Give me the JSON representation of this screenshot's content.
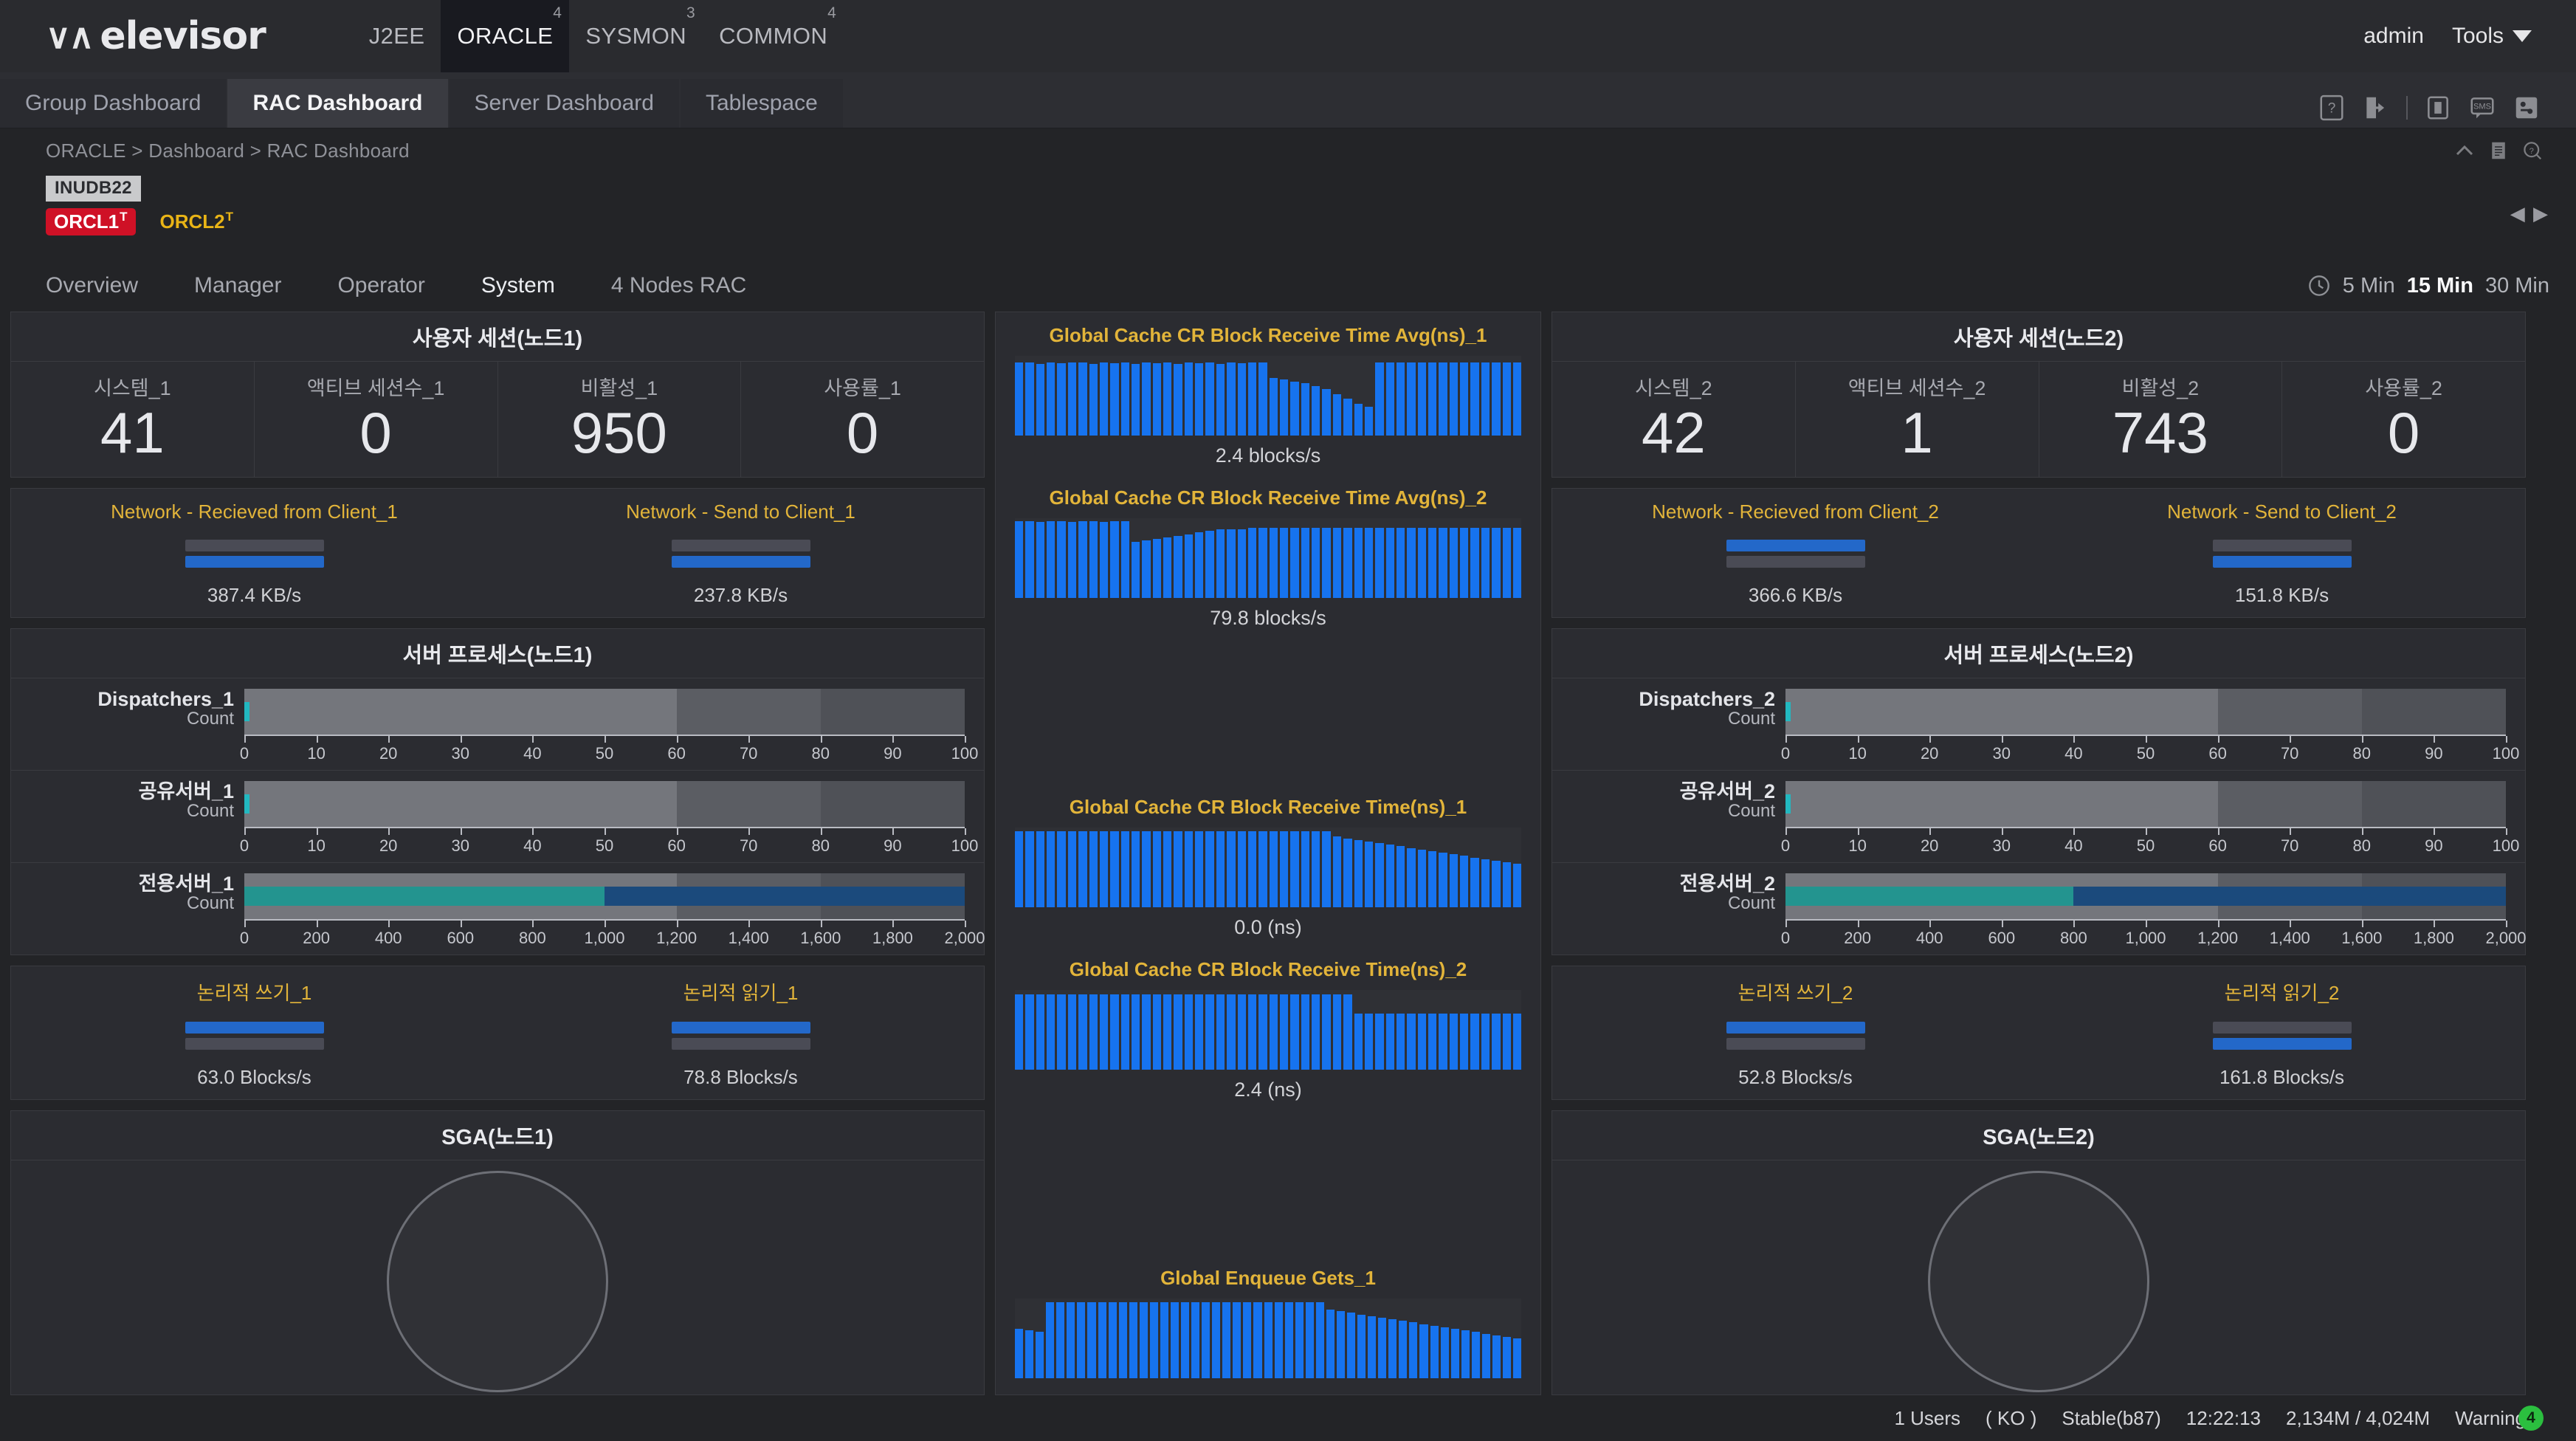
{
  "app": {
    "logo_text": "elevisor",
    "admin_label": "admin",
    "tools_label": "Tools"
  },
  "module_tabs": [
    {
      "label": "J2EE",
      "badge": "",
      "active": false
    },
    {
      "label": "ORACLE",
      "badge": "4",
      "active": true
    },
    {
      "label": "SYSMON",
      "badge": "3",
      "active": false
    },
    {
      "label": "COMMON",
      "badge": "4",
      "active": false
    }
  ],
  "tabs": [
    {
      "label": "Group Dashboard",
      "active": false
    },
    {
      "label": "RAC Dashboard",
      "active": true
    },
    {
      "label": "Server Dashboard",
      "active": false
    },
    {
      "label": "Tablespace",
      "active": false
    }
  ],
  "breadcrumb": "ORACLE > Dashboard > RAC Dashboard",
  "instances": {
    "db_tag": "INUDB22",
    "nodes": [
      {
        "label": "ORCL1",
        "sup": "T",
        "state": "red"
      },
      {
        "label": "ORCL2",
        "sup": "T",
        "state": "amber"
      }
    ],
    "arrows": "◀ ▶"
  },
  "subnav": [
    {
      "label": "Overview",
      "active": false
    },
    {
      "label": "Manager",
      "active": false
    },
    {
      "label": "Operator",
      "active": false
    },
    {
      "label": "System",
      "active": true
    },
    {
      "label": "4 Nodes RAC",
      "active": false
    }
  ],
  "time_range": {
    "options": [
      "5 Min",
      "15 Min",
      "30 Min"
    ],
    "selected": "15 Min"
  },
  "node1": {
    "session_panel_title": "사용자 세션(노드1)",
    "session_cells": [
      {
        "label": "시스템_1",
        "value": "41"
      },
      {
        "label": "액티브 세션수_1",
        "value": "0"
      },
      {
        "label": "비활성_1",
        "value": "950"
      },
      {
        "label": "사용률_1",
        "value": "0"
      }
    ],
    "network": [
      {
        "title": "Network - Recieved from Client_1",
        "value": "387.4 KB/s",
        "order": "grey-top"
      },
      {
        "title": "Network - Send to Client_1",
        "value": "237.8 KB/s",
        "order": "grey-top"
      }
    ],
    "process_panel_title": "서버 프로세스(노드1)",
    "processes": [
      {
        "name": "Dispatchers_1",
        "sub": "Count",
        "max": 100,
        "teal": 0,
        "navy": 0,
        "cyan": 1,
        "ticks": [
          "0",
          "10",
          "20",
          "30",
          "40",
          "50",
          "60",
          "70",
          "80",
          "90",
          "100"
        ]
      },
      {
        "name": "공유서버_1",
        "sub": "Count",
        "max": 100,
        "teal": 0,
        "navy": 0,
        "cyan": 1,
        "ticks": [
          "0",
          "10",
          "20",
          "30",
          "40",
          "50",
          "60",
          "70",
          "80",
          "90",
          "100"
        ]
      },
      {
        "name": "전용서버_1",
        "sub": "Count",
        "max": 2000,
        "teal": 1000,
        "navy": 2000,
        "cyan": 0,
        "ticks": [
          "0",
          "200",
          "400",
          "600",
          "800",
          "1,000",
          "1,200",
          "1,400",
          "1,600",
          "1,800",
          "2,000"
        ]
      }
    ],
    "logical": [
      {
        "title": "논리적 쓰기_1",
        "value": "63.0 Blocks/s",
        "order": "blue-top"
      },
      {
        "title": "논리적 읽기_1",
        "value": "78.8 Blocks/s",
        "order": "blue-top"
      }
    ],
    "sga_title": "SGA(노드1)"
  },
  "node2": {
    "session_panel_title": "사용자 세션(노드2)",
    "session_cells": [
      {
        "label": "시스템_2",
        "value": "42"
      },
      {
        "label": "액티브 세션수_2",
        "value": "1"
      },
      {
        "label": "비활성_2",
        "value": "743"
      },
      {
        "label": "사용률_2",
        "value": "0"
      }
    ],
    "network": [
      {
        "title": "Network - Recieved from Client_2",
        "value": "366.6 KB/s",
        "order": "blue-top"
      },
      {
        "title": "Network - Send to Client_2",
        "value": "151.8 KB/s",
        "order": "grey-top"
      }
    ],
    "process_panel_title": "서버 프로세스(노드2)",
    "processes": [
      {
        "name": "Dispatchers_2",
        "sub": "Count",
        "max": 100,
        "teal": 0,
        "navy": 0,
        "cyan": 1,
        "ticks": [
          "0",
          "10",
          "20",
          "30",
          "40",
          "50",
          "60",
          "70",
          "80",
          "90",
          "100"
        ]
      },
      {
        "name": "공유서버_2",
        "sub": "Count",
        "max": 100,
        "teal": 0,
        "navy": 0,
        "cyan": 1,
        "ticks": [
          "0",
          "10",
          "20",
          "30",
          "40",
          "50",
          "60",
          "70",
          "80",
          "90",
          "100"
        ]
      },
      {
        "name": "전용서버_2",
        "sub": "Count",
        "max": 2000,
        "teal": 800,
        "navy": 2000,
        "cyan": 0,
        "ticks": [
          "0",
          "200",
          "400",
          "600",
          "800",
          "1,000",
          "1,200",
          "1,400",
          "1,600",
          "1,800",
          "2,000"
        ]
      }
    ],
    "logical": [
      {
        "title": "논리적 쓰기_2",
        "value": "52.8 Blocks/s",
        "order": "blue-top"
      },
      {
        "title": "논리적 읽기_2",
        "value": "161.8 Blocks/s",
        "order": "grey-top"
      }
    ],
    "sga_title": "SGA(노드2)"
  },
  "statusbar": {
    "users": "1 Users",
    "locale": "( KO )",
    "build": "Stable(b87)",
    "time": "12:22:13",
    "memory": "2,134M / 4,024M",
    "warning_label": "Warning",
    "warning_count": "4",
    "warning_color": "#2bbf3f"
  },
  "chart_data": [
    {
      "type": "bar",
      "title": "Global Cache CR Block Receive Time Avg(ns)_1",
      "value_label": "2.4 blocks/s",
      "ylabel": "blocks/s",
      "bright_ranges": [
        [
          0,
          24
        ],
        [
          34,
          48
        ]
      ],
      "values": [
        92,
        92,
        90,
        92,
        91,
        92,
        92,
        90,
        92,
        91,
        92,
        90,
        92,
        91,
        92,
        90,
        92,
        91,
        92,
        90,
        92,
        91,
        92,
        92,
        72,
        70,
        68,
        66,
        62,
        58,
        52,
        46,
        40,
        36,
        92,
        92,
        92,
        92,
        92,
        92,
        92,
        92,
        92,
        92,
        92,
        92,
        92,
        92
      ]
    },
    {
      "type": "bar",
      "title": "Global Cache CR Block Receive Time Avg(ns)_2",
      "value_label": "79.8 blocks/s",
      "ylabel": "blocks/s",
      "bright_ranges": [
        [
          0,
          11
        ]
      ],
      "values": [
        96,
        96,
        95,
        96,
        96,
        95,
        96,
        96,
        95,
        96,
        96,
        70,
        72,
        74,
        76,
        78,
        80,
        82,
        84,
        86,
        86,
        86,
        88,
        88,
        88,
        88,
        88,
        88,
        88,
        88,
        88,
        88,
        88,
        88,
        88,
        88,
        88,
        88,
        88,
        88,
        88,
        88,
        88,
        88,
        88,
        88,
        88,
        88
      ]
    },
    {
      "type": "bar",
      "title": "Global Cache CR Block Receive Time(ns)_1",
      "value_label": "0.0 (ns)",
      "ylabel": "ns",
      "bright_ranges": [
        [
          0,
          30
        ]
      ],
      "values": [
        95,
        95,
        95,
        95,
        95,
        95,
        95,
        95,
        95,
        95,
        95,
        95,
        95,
        95,
        95,
        95,
        95,
        95,
        95,
        95,
        95,
        95,
        95,
        95,
        95,
        95,
        95,
        95,
        95,
        95,
        88,
        86,
        84,
        82,
        80,
        78,
        76,
        74,
        72,
        70,
        68,
        66,
        64,
        62,
        60,
        58,
        56,
        54
      ]
    },
    {
      "type": "bar",
      "title": "Global Cache CR Block Receive Time(ns)_2",
      "value_label": "2.4 (ns)",
      "ylabel": "ns",
      "bright_ranges": [
        [
          0,
          32
        ]
      ],
      "values": [
        94,
        94,
        94,
        94,
        94,
        94,
        94,
        94,
        94,
        94,
        94,
        94,
        94,
        94,
        94,
        94,
        94,
        94,
        94,
        94,
        94,
        94,
        94,
        94,
        94,
        94,
        94,
        94,
        94,
        94,
        94,
        94,
        70,
        70,
        70,
        70,
        70,
        70,
        70,
        70,
        70,
        70,
        70,
        70,
        70,
        70,
        70,
        70
      ]
    },
    {
      "type": "bar",
      "title": "Global Enqueue Gets_1",
      "value_label": "",
      "ylabel": "",
      "bright_ranges": [
        [
          3,
          30
        ]
      ],
      "values": [
        62,
        60,
        58,
        95,
        95,
        95,
        95,
        95,
        95,
        95,
        95,
        95,
        95,
        95,
        95,
        95,
        95,
        95,
        95,
        95,
        95,
        95,
        95,
        95,
        95,
        95,
        95,
        95,
        95,
        95,
        86,
        84,
        82,
        80,
        78,
        76,
        74,
        72,
        70,
        68,
        66,
        64,
        62,
        60,
        58,
        56,
        54,
        52,
        50
      ]
    }
  ]
}
